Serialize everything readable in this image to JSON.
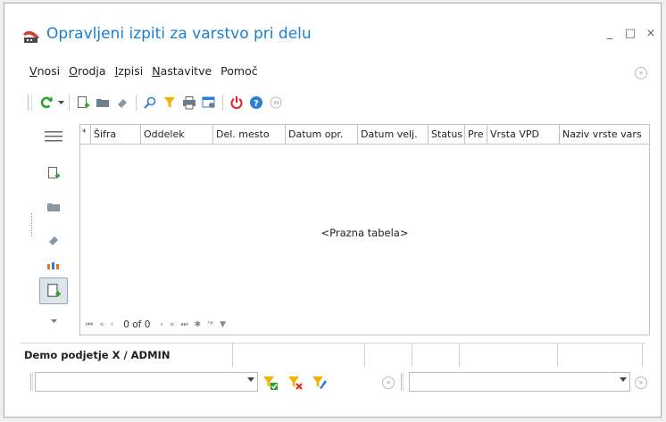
{
  "window": {
    "title": "Opravljeni izpiti za varstvo pri delu",
    "controls": {
      "minimize": "_",
      "maximize": "□",
      "close": "×"
    }
  },
  "menu": [
    {
      "label": "Vnosi",
      "accel": "V",
      "rest": "nosi"
    },
    {
      "label": "Orodja",
      "accel": "O",
      "rest": "rodja"
    },
    {
      "label": "Izpisi",
      "accel": "I",
      "rest": "zpisi"
    },
    {
      "label": "Nastavitve",
      "accel": "N",
      "rest": "astavitve"
    },
    {
      "label": "Pomoč",
      "accel": "",
      "rest": "Pomoč"
    }
  ],
  "toolbar": {
    "icons": [
      "refresh-icon",
      "new-document-icon",
      "open-folder-icon",
      "eraser-icon",
      "search-icon",
      "filter-icon",
      "print-icon",
      "grid-settings-icon",
      "power-icon",
      "help-icon",
      "more-icon"
    ]
  },
  "sidebar": {
    "icons": [
      "hamburger-icon",
      "new-document-icon",
      "folder-icon",
      "eraser-icon",
      "people-icon",
      "new-document-icon",
      "chevron-down-icon"
    ]
  },
  "grid": {
    "columns": [
      {
        "label": "*"
      },
      {
        "label": "Šifra"
      },
      {
        "label": "Oddelek"
      },
      {
        "label": "Del. mesto"
      },
      {
        "label": "Datum opr."
      },
      {
        "label": "Datum velj."
      },
      {
        "label": "Status"
      },
      {
        "label": "Pre"
      },
      {
        "label": "Vrsta VPD"
      },
      {
        "label": "Naziv vrste vars"
      }
    ],
    "empty_text": "<Prazna tabela>",
    "nav": {
      "count": "0 of 0"
    }
  },
  "status": {
    "main": "Demo podjetje X / ADMIN"
  },
  "filter": {
    "left_value": "",
    "right_value": ""
  },
  "colors": {
    "title": "#1a7fd0",
    "refresh": "#2aa32a",
    "filter": "#f2b200",
    "power": "#e02020",
    "help": "#2a7fd4"
  }
}
